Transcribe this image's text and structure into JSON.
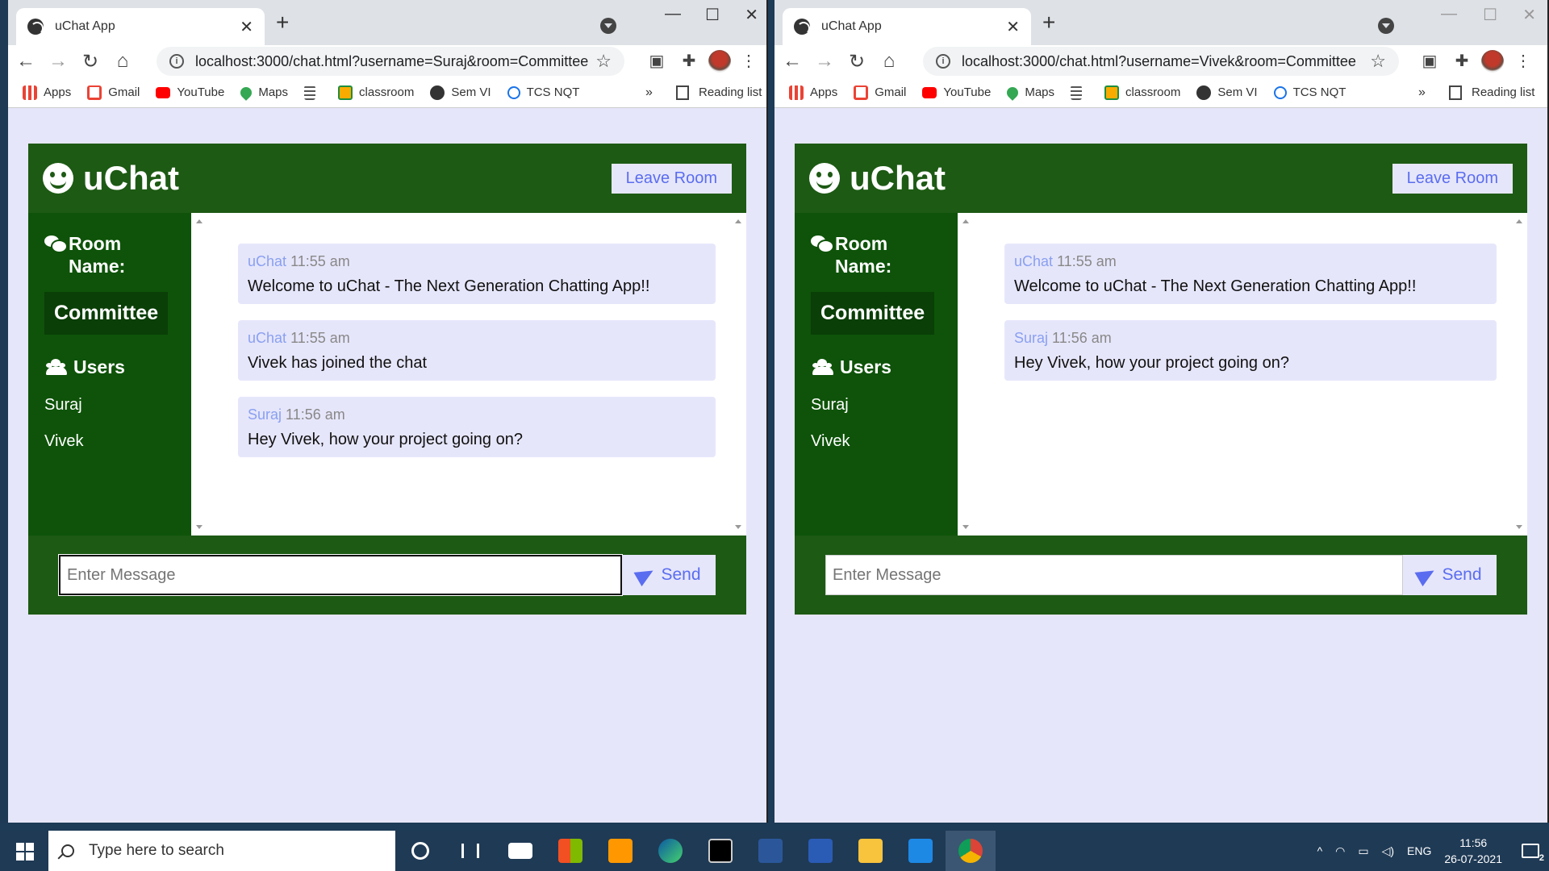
{
  "windows": [
    {
      "tab_title": "uChat App",
      "url": "localhost:3000/chat.html?username=Suraj&room=Committee",
      "bookmarks": [
        "Apps",
        "Gmail",
        "YouTube",
        "Maps",
        "",
        "classroom",
        "Sem VI",
        "TCS NQT"
      ],
      "bookmarks_more": "»",
      "reading_list": "Reading list",
      "brand": "uChat",
      "leave_label": "Leave Room",
      "room_label": "Room Name:",
      "room_name": "Committee",
      "users_label": "Users",
      "users": [
        "Suraj",
        "Vivek"
      ],
      "messages": [
        {
          "user": "uChat",
          "time": "11:55 am",
          "text": "Welcome to uChat - The Next Generation Chatting App!!"
        },
        {
          "user": "uChat",
          "time": "11:55 am",
          "text": "Vivek has joined the chat"
        },
        {
          "user": "Suraj",
          "time": "11:56 am",
          "text": "Hey Vivek, how your project going on?"
        }
      ],
      "input_placeholder": "Enter Message",
      "send_label": "Send"
    },
    {
      "tab_title": "uChat App",
      "url": "localhost:3000/chat.html?username=Vivek&room=Committee",
      "bookmarks": [
        "Apps",
        "Gmail",
        "YouTube",
        "Maps",
        "",
        "classroom",
        "Sem VI",
        "TCS NQT"
      ],
      "bookmarks_more": "»",
      "reading_list": "Reading list",
      "brand": "uChat",
      "leave_label": "Leave Room",
      "room_label": "Room Name:",
      "room_name": "Committee",
      "users_label": "Users",
      "users": [
        "Suraj",
        "Vivek"
      ],
      "messages": [
        {
          "user": "uChat",
          "time": "11:55 am",
          "text": "Welcome to uChat - The Next Generation Chatting App!!"
        },
        {
          "user": "Suraj",
          "time": "11:56 am",
          "text": "Hey Vivek, how your project going on?"
        }
      ],
      "input_placeholder": "Enter Message",
      "send_label": "Send"
    }
  ],
  "taskbar": {
    "search_placeholder": "Type here to search",
    "language": "ENG",
    "time": "11:56",
    "date": "26-07-2021",
    "notification_count": "2"
  },
  "colors": {
    "app_green": "#1d5a14",
    "sidebar_green": "#0e5309",
    "accent_blue": "#5a6df0",
    "page_bg": "#e6e6fb"
  }
}
